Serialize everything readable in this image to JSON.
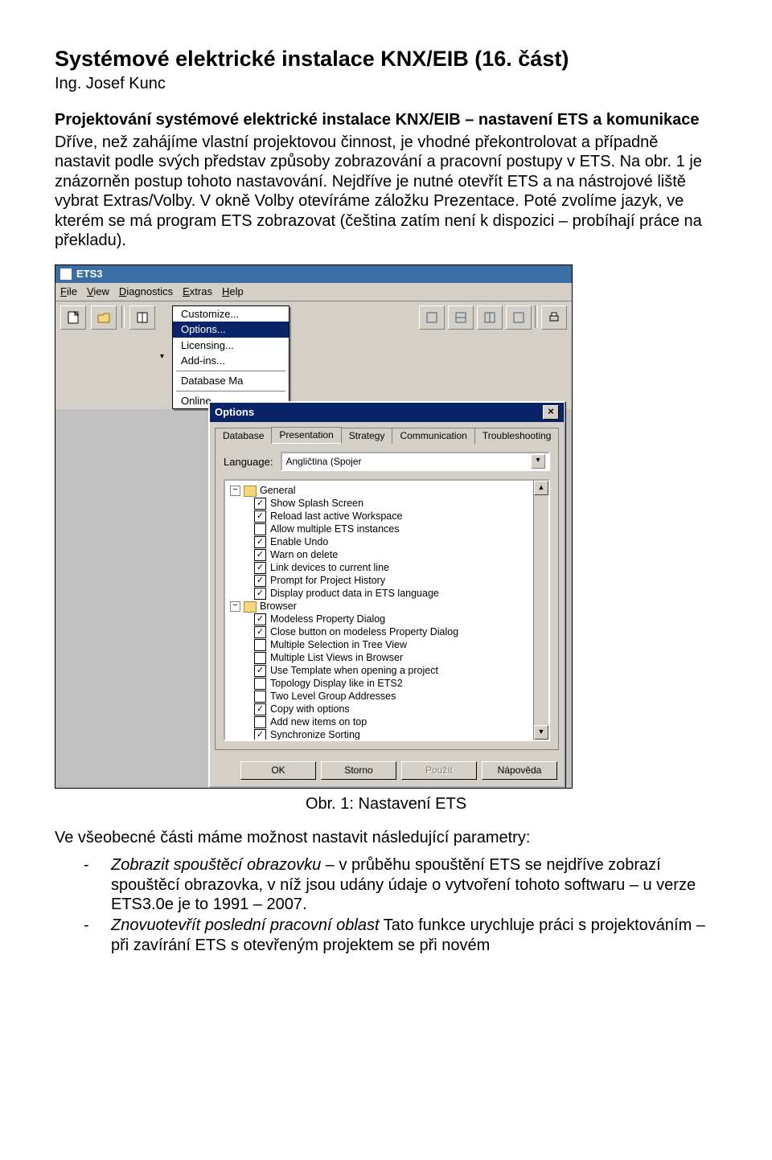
{
  "doc": {
    "title": "Systémové elektrické instalace KNX/EIB (16. část)",
    "author": "Ing. Josef Kunc",
    "subtitle": "Projektování systémové elektrické instalace KNX/EIB – nastavení ETS a komunikace",
    "para1": "Dříve, než zahájíme vlastní projektovou činnost, je vhodné překontrolovat a případně nastavit podle svých představ způsoby zobrazování a pracovní postupy v ETS. Na obr. 1 je znázorněn postup tohoto nastavování. Nejdříve je nutné otevřít ETS a na nástrojové liště vybrat Extras/Volby. V okně Volby otevíráme záložku Prezentace. Poté zvolíme jazyk, ve kterém se má program ETS zobrazovat (čeština zatím není k dispozici – probíhají práce na překladu).",
    "figcaption": "Obr. 1: Nastavení ETS",
    "para2_lead": "Ve všeobecné části máme možnost nastavit následující parametry:",
    "bullet1_em": "Zobrazit spouštěcí obrazovku",
    "bullet1_rest": " – v průběhu spouštění ETS se nejdříve zobrazí spouštěcí obrazovka, v níž jsou udány údaje o vytvoření tohoto softwaru – u verze ETS3.0e je to 1991 – 2007.",
    "bullet2_em": "Znovuotevřít poslední pracovní oblast",
    "bullet2_rest": " Tato funkce urychluje práci s projektováním – při zavírání ETS s otevřeným projektem se při novém"
  },
  "ets": {
    "app_title": "ETS3",
    "menus": [
      "File",
      "View",
      "Diagnostics",
      "Extras",
      "Help"
    ],
    "extras_menu": {
      "items": [
        "Customize...",
        "Options...",
        "Licensing...",
        "Add-ins...",
        "Database Ma",
        "Online"
      ],
      "selected": "Options..."
    },
    "options": {
      "title": "Options",
      "tabs": [
        "Database",
        "Presentation",
        "Strategy",
        "Communication",
        "Troubleshooting"
      ],
      "active_tab": "Presentation",
      "language_label": "Language:",
      "language_value": "Angličtina (Spojer",
      "sections": [
        {
          "name": "General",
          "items": [
            {
              "label": "Show Splash Screen",
              "checked": true
            },
            {
              "label": "Reload last active Workspace",
              "checked": true
            },
            {
              "label": "Allow multiple ETS instances",
              "checked": false
            },
            {
              "label": "Enable Undo",
              "checked": true
            },
            {
              "label": "Warn on delete",
              "checked": true
            },
            {
              "label": "Link devices to current line",
              "checked": true
            },
            {
              "label": "Prompt for Project History",
              "checked": true
            },
            {
              "label": "Display product data in ETS language",
              "checked": true
            }
          ]
        },
        {
          "name": "Browser",
          "items": [
            {
              "label": "Modeless Property Dialog",
              "checked": true
            },
            {
              "label": "Close button on modeless Property Dialog",
              "checked": true
            },
            {
              "label": "Multiple Selection in Tree View",
              "checked": false
            },
            {
              "label": "Multiple List Views in Browser",
              "checked": false
            },
            {
              "label": "Use Template when opening a project",
              "checked": true
            },
            {
              "label": "Topology Display like in ETS2",
              "checked": false
            },
            {
              "label": "Two Level Group Addresses",
              "checked": false
            },
            {
              "label": "Copy with options",
              "checked": true
            },
            {
              "label": "Add new items on top",
              "checked": false
            },
            {
              "label": "Synchronize Sorting",
              "checked": true
            }
          ]
        }
      ],
      "buttons": {
        "ok": "OK",
        "cancel": "Storno",
        "apply": "Použít",
        "help": "Nápověda"
      }
    }
  }
}
